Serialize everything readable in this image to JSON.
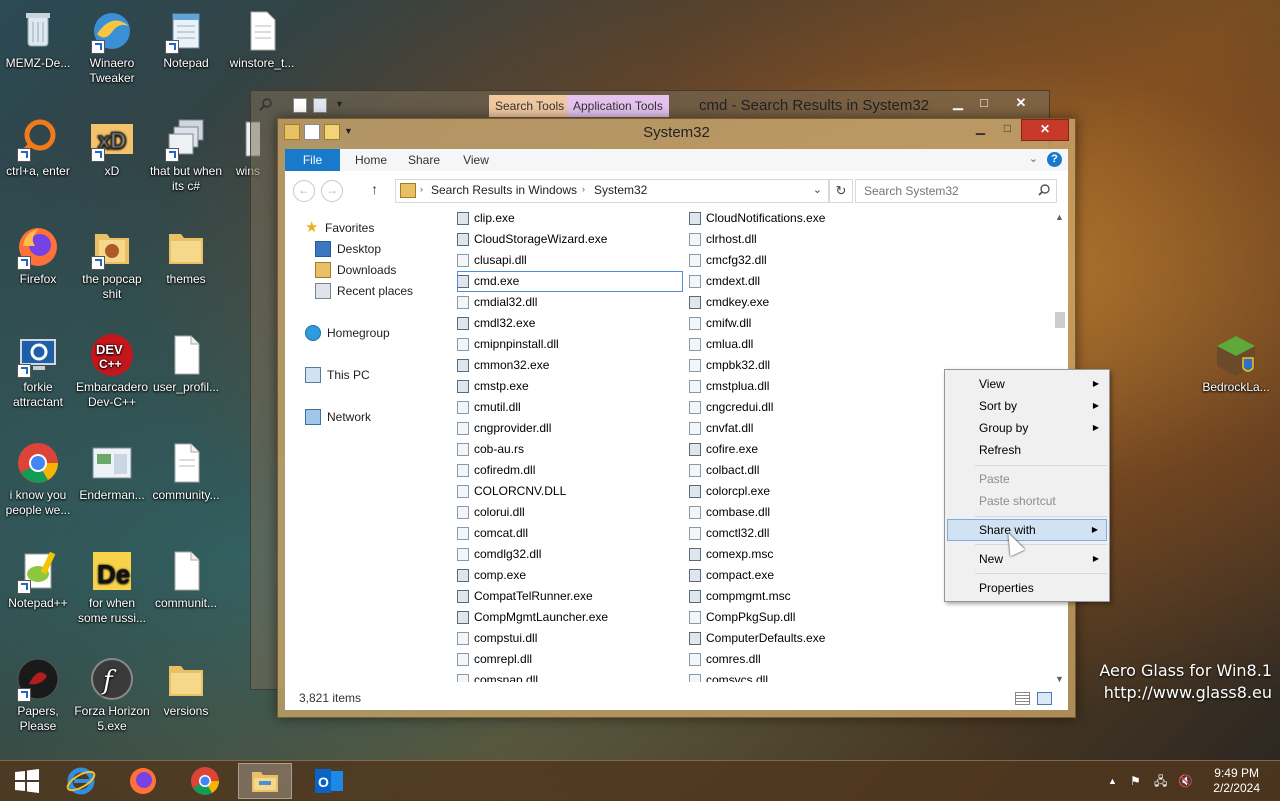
{
  "desktop": {
    "icons": [
      {
        "label": "MEMZ-De...",
        "icon": "recycle-bin-icon"
      },
      {
        "label": "Winaero Tweaker",
        "icon": "winaero-icon"
      },
      {
        "label": "Notepad",
        "icon": "notepad-icon"
      },
      {
        "label": "winstore_t...",
        "icon": "document-icon"
      },
      {
        "label": "ctrl+a, enter",
        "icon": "search-ring-icon"
      },
      {
        "label": "xD",
        "icon": "xd-icon"
      },
      {
        "label": "that but when its c#",
        "icon": "windows-stack-icon"
      },
      {
        "label": "wins",
        "icon": "window-icon"
      },
      {
        "label": "Firefox",
        "icon": "firefox-icon"
      },
      {
        "label": "the popcap shit",
        "icon": "folder-icon"
      },
      {
        "label": "themes",
        "icon": "folder-icon"
      },
      {
        "label": "forkie attractant",
        "icon": "settings-monitor-icon"
      },
      {
        "label": "Embarcadero Dev-C++",
        "icon": "devcpp-icon"
      },
      {
        "label": "user_profil...",
        "icon": "document-icon"
      },
      {
        "label": "i know you people we...",
        "icon": "chrome-icon"
      },
      {
        "label": "Enderman...",
        "icon": "screenshot-icon"
      },
      {
        "label": "community...",
        "icon": "document-icon"
      },
      {
        "label": "Notepad++",
        "icon": "notepadpp-icon"
      },
      {
        "label": "for when some russi...",
        "icon": "de-icon"
      },
      {
        "label": "communit...",
        "icon": "document-icon"
      },
      {
        "label": "Papers, Please",
        "icon": "papers-please-icon"
      },
      {
        "label": "Forza Horizon 5.exe",
        "icon": "flash-icon"
      },
      {
        "label": "versions",
        "icon": "folder-icon"
      },
      {
        "label": "BedrockLa...",
        "icon": "minecraft-icon"
      }
    ]
  },
  "back_window": {
    "title": "cmd - Search Results in System32",
    "context_tabs": [
      "Search Tools",
      "Application Tools"
    ]
  },
  "window": {
    "title": "System32",
    "ribbon_tabs": [
      "File",
      "Home",
      "Share",
      "View"
    ],
    "address_crumbs": [
      "Search Results in Windows",
      "System32"
    ],
    "search_placeholder": "Search System32",
    "nav": {
      "favorites": "Favorites",
      "desktop": "Desktop",
      "downloads": "Downloads",
      "recent": "Recent places",
      "homegroup": "Homegroup",
      "thispc": "This PC",
      "network": "Network"
    },
    "files_col1": [
      "clip.exe",
      "CloudStorageWizard.exe",
      "clusapi.dll",
      "cmd.exe",
      "cmdial32.dll",
      "cmdl32.exe",
      "cmipnpinstall.dll",
      "cmmon32.exe",
      "cmstp.exe",
      "cmutil.dll",
      "cngprovider.dll",
      "cob-au.rs",
      "cofiredm.dll",
      "COLORCNV.DLL",
      "colorui.dll",
      "comcat.dll",
      "comdlg32.dll",
      "comp.exe",
      "CompatTelRunner.exe",
      "CompMgmtLauncher.exe",
      "compstui.dll",
      "comrepl.dll",
      "comsnap.dll"
    ],
    "files_col2": [
      "CloudNotifications.exe",
      "clrhost.dll",
      "cmcfg32.dll",
      "cmdext.dll",
      "cmdkey.exe",
      "cmifw.dll",
      "cmlua.dll",
      "cmpbk32.dll",
      "cmstplua.dll",
      "cngcredui.dll",
      "cnvfat.dll",
      "cofire.exe",
      "colbact.dll",
      "colorcpl.exe",
      "combase.dll",
      "comctl32.dll",
      "comexp.msc",
      "compact.exe",
      "compmgmt.msc",
      "CompPkgSup.dll",
      "ComputerDefaults.exe",
      "comres.dll",
      "comsvcs.dll"
    ],
    "selected_file": "cmd.exe",
    "status": "3,821 items"
  },
  "context_menu": {
    "view": "View",
    "sort_by": "Sort by",
    "group_by": "Group by",
    "refresh": "Refresh",
    "paste": "Paste",
    "paste_shortcut": "Paste shortcut",
    "share_with": "Share with",
    "new": "New",
    "properties": "Properties"
  },
  "watermark": {
    "line1": "Aero Glass for Win8.1",
    "line2": "http://www.glass8.eu"
  },
  "taskbar": {
    "time": "9:49 PM",
    "date": "2/2/2024",
    "apps": [
      "internet-explorer-icon",
      "firefox-icon",
      "chrome-icon",
      "file-explorer-icon",
      "outlook-icon"
    ]
  },
  "colors": {
    "file_tab": "#1979ca",
    "close_button": "#c7392b",
    "menu_highlight": "#d1e2f2"
  }
}
